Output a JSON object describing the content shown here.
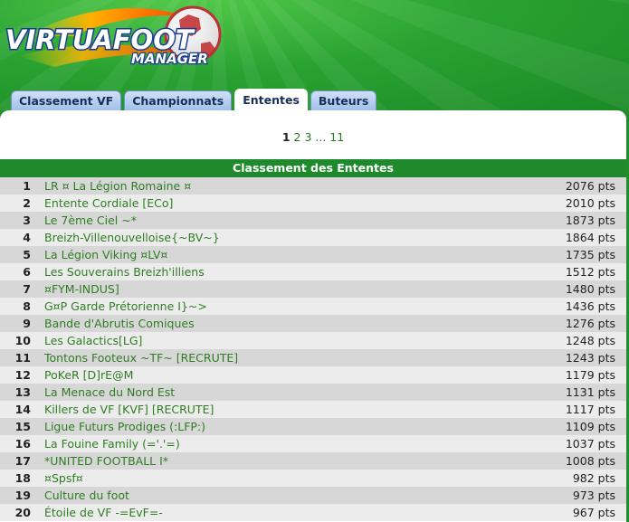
{
  "logo": {
    "line1": "VIRTUAFOOT",
    "line2": "MANAGER"
  },
  "tabs": [
    {
      "label": "Classement VF",
      "active": false
    },
    {
      "label": "Championnats",
      "active": false
    },
    {
      "label": "Ententes",
      "active": true
    },
    {
      "label": "Buteurs",
      "active": false
    }
  ],
  "pagination": {
    "current": "1",
    "pages": [
      "2",
      "3"
    ],
    "ellipsis": "...",
    "last": "11"
  },
  "table": {
    "title": "Classement des Ententes",
    "rows": [
      {
        "rank": "1",
        "name": "LR ¤ La Légion Romaine ¤",
        "points": "2076 pts"
      },
      {
        "rank": "2",
        "name": "Entente Cordiale [ECo]",
        "points": "2010 pts"
      },
      {
        "rank": "3",
        "name": "Le 7ème Ciel ~*",
        "points": "1873 pts"
      },
      {
        "rank": "4",
        "name": "Breizh-Villenouvelloise{~BV~}",
        "points": "1864 pts"
      },
      {
        "rank": "5",
        "name": "La Légion Viking ¤LV¤",
        "points": "1735 pts"
      },
      {
        "rank": "6",
        "name": "Les Souverains Breizh'illiens",
        "points": "1512 pts"
      },
      {
        "rank": "7",
        "name": "¤FYM-INDUS]",
        "points": "1480 pts"
      },
      {
        "rank": "8",
        "name": "G¤P Garde Prétorienne I}~>",
        "points": "1436 pts"
      },
      {
        "rank": "9",
        "name": "Bande d'Abrutis Comiques",
        "points": "1276 pts"
      },
      {
        "rank": "10",
        "name": "Les Galactics[LG]",
        "points": "1248 pts"
      },
      {
        "rank": "11",
        "name": "Tontons Footeux ~TF~ [RECRUTE]",
        "points": "1243 pts"
      },
      {
        "rank": "12",
        "name": "PoKeR [D]rE@M",
        "points": "1179 pts"
      },
      {
        "rank": "13",
        "name": "La Menace du Nord Est",
        "points": "1131 pts"
      },
      {
        "rank": "14",
        "name": "Killers de VF [KVF] [RECRUTE]",
        "points": "1117 pts"
      },
      {
        "rank": "15",
        "name": "Ligue Futurs Prodiges (:LFP:)",
        "points": "1109 pts"
      },
      {
        "rank": "16",
        "name": "La Fouine Family (='.'=)",
        "points": "1037 pts"
      },
      {
        "rank": "17",
        "name": "*UNITED FOOTBALL I*",
        "points": "1008 pts"
      },
      {
        "rank": "18",
        "name": "¤Spsf¤",
        "points": "982 pts"
      },
      {
        "rank": "19",
        "name": "Culture du foot",
        "points": "973 pts"
      },
      {
        "rank": "20",
        "name": "Étoile de VF -=EvF=-",
        "points": "967 pts"
      }
    ]
  },
  "colors": {
    "header_green": "#1f8f2a",
    "title_bar": "#1e8a2c",
    "link_green": "#2f7d22",
    "tab_blue": "#9fbfe9",
    "row_odd": "#d7d7d7",
    "row_even": "#ececec"
  }
}
